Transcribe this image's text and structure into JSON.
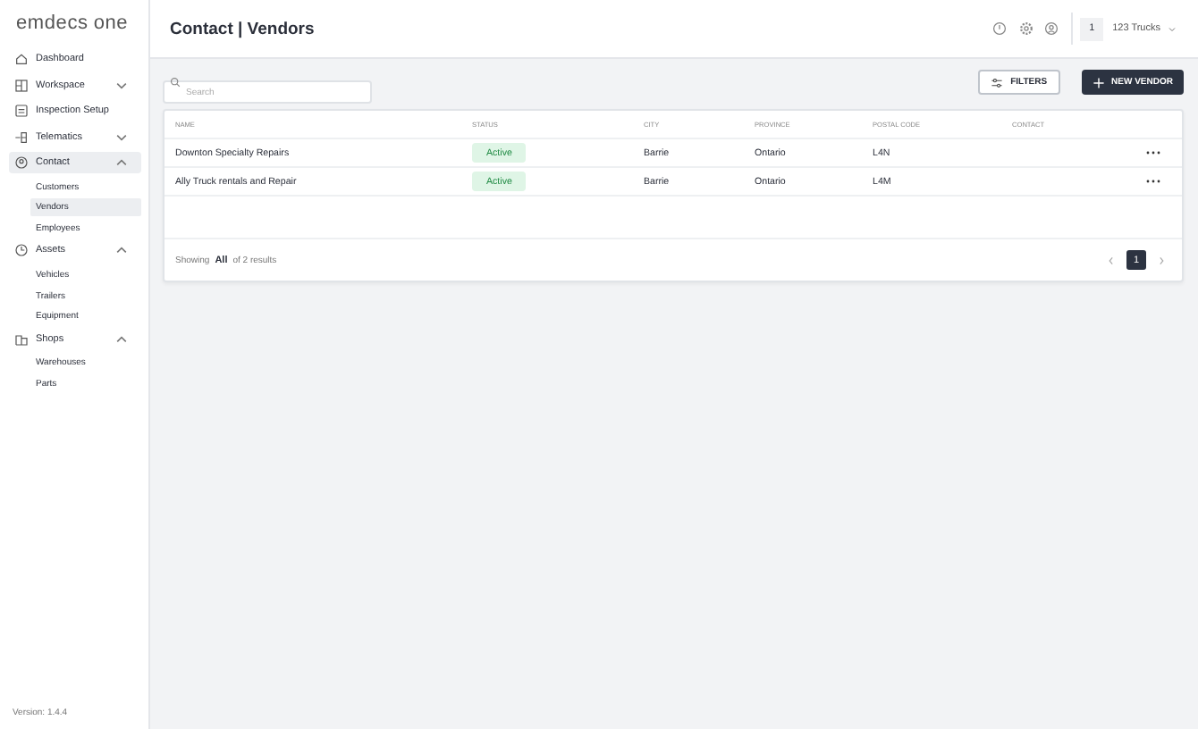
{
  "sidebar": {
    "logo": {
      "text": "emdecs",
      "accent": "one"
    },
    "items": [
      {
        "label": "Dashboard",
        "kind": "link",
        "selected": false
      },
      {
        "label": "Workspace",
        "kind": "group",
        "expanded": false,
        "selected": false
      },
      {
        "label": "Inspection Setup",
        "kind": "link",
        "selected": false
      },
      {
        "label": "Telematics",
        "kind": "group",
        "expanded": false,
        "selected": false
      },
      {
        "label": "Contact",
        "kind": "group",
        "expanded": true,
        "selected": true,
        "children": [
          {
            "label": "Customers",
            "selected": false
          },
          {
            "label": "Vendors",
            "selected": true
          },
          {
            "label": "Employees",
            "selected": false
          }
        ]
      },
      {
        "label": "Assets",
        "kind": "group",
        "expanded": true,
        "selected": false,
        "children": [
          {
            "label": "Vehicles",
            "selected": false
          },
          {
            "label": "Trailers",
            "selected": false
          },
          {
            "label": "Equipment",
            "selected": false
          }
        ]
      },
      {
        "label": "Shops",
        "kind": "group",
        "expanded": true,
        "selected": false,
        "children": [
          {
            "label": "Warehouses",
            "selected": false
          },
          {
            "label": "Parts",
            "selected": false
          }
        ]
      }
    ],
    "version": "Version: 1.4.4"
  },
  "header": {
    "title": "Contact | Vendors",
    "company_badge": "1",
    "company": "123 Trucks"
  },
  "toolbar": {
    "search": {
      "placeholder": "Search"
    },
    "filters_button": "FILTERS",
    "new_button": "NEW VENDOR"
  },
  "table": {
    "columns": [
      "NAME",
      "STATUS",
      "CITY",
      "PROVINCE",
      "POSTAL CODE",
      "CONTACT"
    ],
    "rows": [
      {
        "name": "Downton Specialty Repairs",
        "status": "Active",
        "active": true,
        "city": "Barrie",
        "province": "Ontario",
        "postal_code": "L4N"
      },
      {
        "name": "Ally Truck rentals and Repair",
        "status": "Active",
        "active": true,
        "city": "Barrie",
        "province": "Ontario",
        "postal_code": "L4M"
      }
    ],
    "footer": {
      "showing": "Showing",
      "page_size": "All",
      "results": "of 2 results"
    },
    "pages": [
      {
        "label": "1",
        "selected": true
      }
    ]
  }
}
